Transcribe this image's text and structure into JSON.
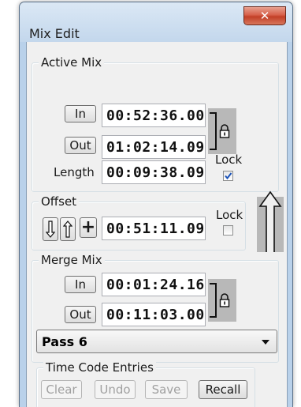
{
  "window": {
    "title": "Mix Edit",
    "close_glyph": "✕"
  },
  "active_mix": {
    "group_title": "Active Mix",
    "in_label": "In",
    "in_value": "00:52:36.00",
    "out_label": "Out",
    "out_value": "01:02:14.09",
    "length_label": "Length",
    "length_value": "00:09:38.09",
    "lock_label": "Lock",
    "lock_checked": true
  },
  "offset": {
    "group_title": "Offset",
    "plus_label": "+",
    "value": "00:51:11.09",
    "lock_label": "Lock",
    "lock_checked": false
  },
  "merge_mix": {
    "group_title": "Merge Mix",
    "in_label": "In",
    "in_value": "00:01:24.16",
    "out_label": "Out",
    "out_value": "00:11:03.00"
  },
  "pass_select": {
    "selected": "Pass 6"
  },
  "time_code_entries": {
    "group_title": "Time Code Entries",
    "buttons": {
      "clear": "Clear",
      "undo": "Undo",
      "save": "Save",
      "recall": "Recall"
    }
  },
  "colors": {
    "checkmark": "#1c53b8",
    "close_button": "#c23f26",
    "title_bar": "#c3d7ec"
  }
}
